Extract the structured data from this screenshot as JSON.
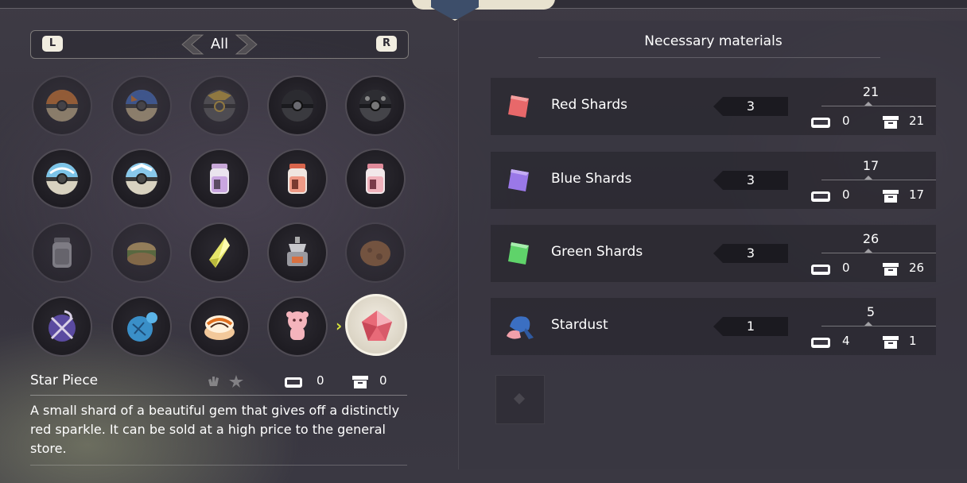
{
  "filter": {
    "label": "All",
    "left_key": "L",
    "right_key": "R"
  },
  "grid": {
    "items": [
      {
        "icon": "pokeball-orange-icon",
        "dim": true
      },
      {
        "icon": "pokeball-blue-icon",
        "dim": true
      },
      {
        "icon": "pokeball-gold-icon",
        "dim": true
      },
      {
        "icon": "pokeball-black-icon",
        "dim": false
      },
      {
        "icon": "pokeball-dark-icon",
        "dim": false
      },
      {
        "icon": "feather-ball-icon",
        "dim": false
      },
      {
        "icon": "wing-ball-icon",
        "dim": false
      },
      {
        "icon": "purple-jar-icon",
        "dim": false
      },
      {
        "icon": "red-jar-icon",
        "dim": false
      },
      {
        "icon": "pink-jar-icon",
        "dim": false
      },
      {
        "icon": "gray-jar-icon",
        "dim": true
      },
      {
        "icon": "cake-icon",
        "dim": true
      },
      {
        "icon": "gem-crystal-icon",
        "dim": false
      },
      {
        "icon": "pot-icon",
        "dim": false
      },
      {
        "icon": "ball-of-mud-icon",
        "dim": true
      },
      {
        "icon": "purple-bundle-icon",
        "dim": false
      },
      {
        "icon": "blue-bundle-icon",
        "dim": false
      },
      {
        "icon": "bun-icon",
        "dim": false
      },
      {
        "icon": "clefairy-doll-icon",
        "dim": false
      },
      {
        "icon": "star-piece-icon",
        "dim": false,
        "selected": true
      }
    ]
  },
  "selected_item": {
    "name": "Star Piece",
    "bag_count": "0",
    "box_count": "0",
    "description": "A small shard of a beautiful gem that gives off a distinctly red sparkle. It can be sold at a high price to the general store."
  },
  "materials": {
    "header": "Necessary materials",
    "items": [
      {
        "name": "Red Shards",
        "required": "3",
        "total": "21",
        "bag": "0",
        "box": "21",
        "color": "#e8686a"
      },
      {
        "name": "Blue Shards",
        "required": "3",
        "total": "17",
        "bag": "0",
        "box": "17",
        "color": "#9a78e8"
      },
      {
        "name": "Green Shards",
        "required": "3",
        "total": "26",
        "bag": "0",
        "box": "26",
        "color": "#5fd36a"
      },
      {
        "name": "Stardust",
        "required": "1",
        "total": "5",
        "bag": "4",
        "box": "1",
        "color": "#3b6fc2"
      }
    ]
  },
  "colors": {
    "accent": "#d6e33a",
    "panel": "#3a3742",
    "tab": "#e8e2cf"
  }
}
